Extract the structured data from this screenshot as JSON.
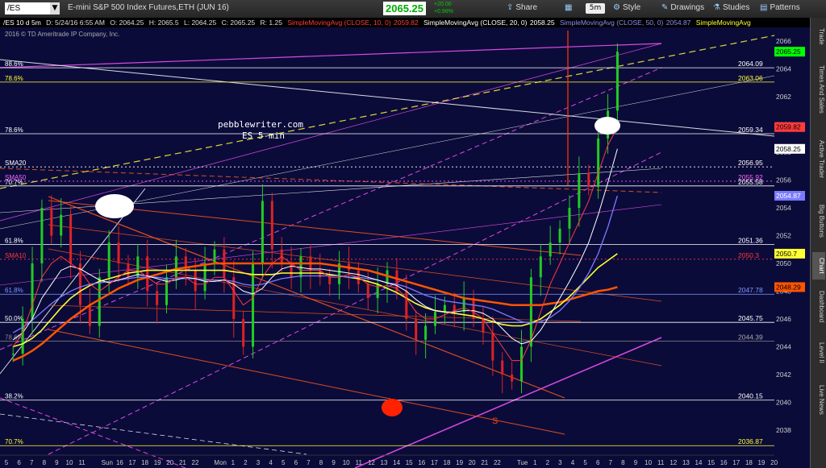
{
  "toolbar": {
    "symbol": "/ES",
    "description": "E-mini S&P 500 Index Futures,ETH (JUN 16)",
    "last_price": "2065.25",
    "change": "+20.00",
    "change_pct": "+0.98%",
    "share_label": "Share",
    "timeframe_label": "5m",
    "style_label": "Style",
    "drawings_label": "Drawings",
    "studies_label": "Studies",
    "patterns_label": "Patterns"
  },
  "infobar": {
    "chart_title": "/ES 10 d 5m",
    "date": "D: 5/24/16 6:55 AM",
    "open": "O: 2064.25",
    "high": "H: 2065.5",
    "low": "L: 2064.25",
    "close": "C: 2065.25",
    "range": "R: 1.25",
    "sma10_label": "SimpleMovingAvg (CLOSE, 10, 0)",
    "sma10_value": "2059.82",
    "sma20_label": "SimpleMovingAvg (CLOSE, 20, 0)",
    "sma20_value": "2058.25",
    "sma50_label": "SimpleMovingAvg (CLOSE, 50, 0)",
    "sma50_value": "2054.87",
    "sma_extra_label": "SimpleMovingAvg",
    "copyright": "2016 © TD Ameritrade IP Company, Inc."
  },
  "sidebar": {
    "tabs": [
      "Trade",
      "Times And Sales",
      "Active Trader",
      "Big Buttons",
      "Chart",
      "Dashboard",
      "Level II",
      "Live News"
    ],
    "active": "Chart"
  },
  "colors": {
    "background": "#0b0b3a",
    "sma10": "#ff3b3b",
    "sma20": "#ffffff",
    "sma50": "#7b7bff",
    "sma_long": "#ff5500",
    "sma_mid": "#ffff33",
    "channel_pink": "#ff55ff",
    "channel_orange": "#ff5a1a",
    "fib_yellow": "#ffff33"
  },
  "chart_data": {
    "type": "candlestick",
    "annotation_title": "pebblewriter.com",
    "annotation_subtitle": "ES 5-min",
    "annotation_s": "S",
    "y_range": [
      2037,
      2067
    ],
    "y_ticks": [
      2038,
      2040,
      2042,
      2044,
      2046,
      2048,
      2050,
      2052,
      2054,
      2056,
      2058,
      2060,
      2062,
      2064,
      2066
    ],
    "x_ticks": [
      {
        "label": "5",
        "i": 0
      },
      {
        "label": "6",
        "i": 1
      },
      {
        "label": "7",
        "i": 2
      },
      {
        "label": "8",
        "i": 3
      },
      {
        "label": "9",
        "i": 4
      },
      {
        "label": "10",
        "i": 5
      },
      {
        "label": "11",
        "i": 6
      },
      {
        "label": "Sun",
        "i": 8
      },
      {
        "label": "16",
        "i": 9
      },
      {
        "label": "17",
        "i": 10
      },
      {
        "label": "18",
        "i": 11
      },
      {
        "label": "19",
        "i": 12
      },
      {
        "label": "20",
        "i": 13
      },
      {
        "label": "21",
        "i": 14
      },
      {
        "label": "22",
        "i": 15
      },
      {
        "label": "Mon",
        "i": 17
      },
      {
        "label": "1",
        "i": 18
      },
      {
        "label": "2",
        "i": 19
      },
      {
        "label": "3",
        "i": 20
      },
      {
        "label": "4",
        "i": 21
      },
      {
        "label": "5",
        "i": 22
      },
      {
        "label": "6",
        "i": 23
      },
      {
        "label": "7",
        "i": 24
      },
      {
        "label": "8",
        "i": 25
      },
      {
        "label": "9",
        "i": 26
      },
      {
        "label": "10",
        "i": 27
      },
      {
        "label": "11",
        "i": 28
      },
      {
        "label": "12",
        "i": 29
      },
      {
        "label": "13",
        "i": 30
      },
      {
        "label": "14",
        "i": 31
      },
      {
        "label": "15",
        "i": 32
      },
      {
        "label": "16",
        "i": 33
      },
      {
        "label": "17",
        "i": 34
      },
      {
        "label": "18",
        "i": 35
      },
      {
        "label": "19",
        "i": 36
      },
      {
        "label": "20",
        "i": 37
      },
      {
        "label": "21",
        "i": 38
      },
      {
        "label": "22",
        "i": 39
      },
      {
        "label": "Tue",
        "i": 41
      },
      {
        "label": "1",
        "i": 42
      },
      {
        "label": "2",
        "i": 43
      },
      {
        "label": "3",
        "i": 44
      },
      {
        "label": "4",
        "i": 45
      },
      {
        "label": "5",
        "i": 46
      },
      {
        "label": "6",
        "i": 47
      },
      {
        "label": "7",
        "i": 48
      },
      {
        "label": "8",
        "i": 49
      },
      {
        "label": "9",
        "i": 50
      },
      {
        "label": "10",
        "i": 51
      },
      {
        "label": "11",
        "i": 52
      },
      {
        "label": "12",
        "i": 53
      },
      {
        "label": "13",
        "i": 54
      },
      {
        "label": "14",
        "i": 55
      },
      {
        "label": "15",
        "i": 56
      },
      {
        "label": "16",
        "i": 57
      },
      {
        "label": "17",
        "i": 58
      },
      {
        "label": "18",
        "i": 59
      },
      {
        "label": "19",
        "i": 60
      },
      {
        "label": "20",
        "i": 61
      }
    ],
    "levels": [
      {
        "value": 2064.09,
        "label": "2064.09",
        "left": "88.6%",
        "color": "#ffffff",
        "style": "solid"
      },
      {
        "value": 2063.06,
        "label": "2063.06",
        "left": "78.6%",
        "color": "#ffff33",
        "style": "solid"
      },
      {
        "value": 2059.34,
        "label": "2059.34",
        "left": "78.6%",
        "color": "#ffffff",
        "style": "solid"
      },
      {
        "value": 2056.95,
        "label": "2056.95",
        "left": "SMA20",
        "color": "#ffffff",
        "style": "dotted"
      },
      {
        "value": 2055.92,
        "label": "2055.92",
        "left": "SMA50",
        "color": "#ff66ff",
        "style": "dotted"
      },
      {
        "value": 2055.58,
        "label": "2055.58",
        "left": "70.7%",
        "color": "#ffffff",
        "style": "solid"
      },
      {
        "value": 2051.36,
        "label": "2051.36",
        "left": "61.8%",
        "color": "#ffffff",
        "style": "solid"
      },
      {
        "value": 2050.3,
        "label": "2050.3",
        "left": "SMA10",
        "color": "#ff3b3b",
        "style": "dotted"
      },
      {
        "value": 2047.78,
        "label": "2047.78",
        "left": "61.8%",
        "color": "#7b9cff",
        "style": "solid"
      },
      {
        "value": 2045.75,
        "label": "2045.75",
        "left": "50.0%",
        "color": "#ffffff",
        "style": "solid"
      },
      {
        "value": 2044.39,
        "label": "2044.39",
        "left": "78.6%",
        "color": "#888888",
        "style": "solid"
      },
      {
        "value": 2040.15,
        "label": "2040.15",
        "left": "38.2%",
        "color": "#ffffff",
        "style": "solid"
      },
      {
        "value": 2036.87,
        "label": "2036.87",
        "left": "70.7%",
        "color": "#ffff33",
        "style": "solid"
      }
    ],
    "price_tags": [
      {
        "value": 2065.25,
        "label": "2065.25",
        "bg": "#00ff00",
        "fg": "#000"
      },
      {
        "value": 2059.82,
        "label": "2059.82",
        "bg": "#ff3b3b",
        "fg": "#000"
      },
      {
        "value": 2058.25,
        "label": "2058.25",
        "bg": "#ffffff",
        "fg": "#000"
      },
      {
        "value": 2054.87,
        "label": "2054.87",
        "bg": "#7b7bff",
        "fg": "#fff"
      },
      {
        "value": 2050.7,
        "label": "2050.7",
        "bg": "#ffff33",
        "fg": "#000"
      },
      {
        "value": 2048.29,
        "label": "2048.29",
        "bg": "#ff5500",
        "fg": "#000"
      }
    ],
    "close_path": [
      2043.5,
      2046,
      2050,
      2054,
      2052,
      2053.5,
      2050,
      2047,
      2045.5,
      2049,
      2051.5,
      2050,
      2049,
      2050.5,
      2048,
      2047,
      2049,
      2050.5,
      2049.5,
      2048,
      2050,
      2051,
      2049,
      2046,
      2044,
      2050,
      2054.5,
      2051,
      2050,
      2049,
      2050.5,
      2049.5,
      2049,
      2048.5,
      2050,
      2049.5,
      2048.5,
      2047.5,
      2048.5,
      2049.5,
      2048,
      2046,
      2044.5,
      2045.5,
      2046.5,
      2047,
      2046.5,
      2047.5,
      2046,
      2045,
      2043,
      2042,
      2041.5,
      2044,
      2049,
      2050.5,
      2051.5,
      2052.5,
      2054,
      2056.5,
      2055.5,
      2059,
      2061,
      2065.25
    ],
    "sma10": [
      2044,
      2045,
      2047,
      2049,
      2050,
      2050.5,
      2050,
      2049.5,
      2048.5,
      2048,
      2048.5,
      2049,
      2049.5,
      2049.5,
      2049,
      2048.5,
      2048.5,
      2049,
      2049,
      2048.5,
      2048.5,
      2049,
      2049,
      2048,
      2047,
      2047.5,
      2049,
      2050,
      2050.5,
      2050,
      2049.5,
      2049.5,
      2049.5,
      2049,
      2049,
      2049.2,
      2049,
      2048.5,
      2048.3,
      2048.4,
      2048.2,
      2047.5,
      2046.5,
      2046,
      2046,
      2046.3,
      2046.6,
      2046.8,
      2046.5,
      2046,
      2045,
      2044,
      2043,
      2043,
      2044.5,
      2046.5,
      2048.5,
      2050,
      2051.5,
      2053,
      2054.5,
      2056.5,
      2058.5,
      2059.82
    ],
    "sma20": [
      2044.5,
      2045,
      2046,
      2047.5,
      2048.5,
      2049.5,
      2049.8,
      2049.6,
      2049.2,
      2048.8,
      2048.6,
      2048.8,
      2049,
      2049.2,
      2049.1,
      2048.9,
      2048.7,
      2048.8,
      2049,
      2048.9,
      2048.7,
      2048.7,
      2048.8,
      2048.5,
      2048,
      2047.8,
      2048.2,
      2049,
      2049.6,
      2049.8,
      2049.7,
      2049.6,
      2049.6,
      2049.5,
      2049.4,
      2049.3,
      2049.2,
      2049,
      2048.8,
      2048.6,
      2048.4,
      2048,
      2047.4,
      2046.9,
      2046.6,
      2046.5,
      2046.5,
      2046.6,
      2046.6,
      2046.4,
      2046,
      2045.3,
      2044.6,
      2044.2,
      2044.4,
      2045.2,
      2046.3,
      2047.5,
      2048.7,
      2050,
      2051.5,
      2053.5,
      2055.8,
      2058.25
    ],
    "sma50": [
      2045,
      2045.4,
      2045.9,
      2046.5,
      2047.1,
      2047.6,
      2048,
      2048.3,
      2048.5,
      2048.6,
      2048.7,
      2048.8,
      2048.9,
      2049,
      2049,
      2049,
      2048.9,
      2048.9,
      2048.9,
      2048.9,
      2048.8,
      2048.8,
      2048.8,
      2048.7,
      2048.5,
      2048.4,
      2048.5,
      2048.7,
      2048.9,
      2049,
      2049.1,
      2049.1,
      2049.1,
      2049.1,
      2049.1,
      2049,
      2049,
      2048.9,
      2048.8,
      2048.6,
      2048.5,
      2048.3,
      2048,
      2047.7,
      2047.5,
      2047.3,
      2047.2,
      2047.1,
      2047,
      2046.9,
      2046.7,
      2046.4,
      2046.1,
      2045.8,
      2045.7,
      2045.8,
      2046.1,
      2046.6,
      2047.3,
      2048.2,
      2049.3,
      2050.7,
      2052.6,
      2054.87
    ],
    "sma_mid": [
      2044,
      2044.2,
      2044.6,
      2045.2,
      2046,
      2046.8,
      2047.5,
      2048,
      2048.4,
      2048.7,
      2048.9,
      2049.1,
      2049.3,
      2049.4,
      2049.5,
      2049.5,
      2049.5,
      2049.5,
      2049.5,
      2049.5,
      2049.5,
      2049.5,
      2049.5,
      2049.4,
      2049.3,
      2049.2,
      2049.2,
      2049.2,
      2049.3,
      2049.3,
      2049.3,
      2049.3,
      2049.3,
      2049.2,
      2049.1,
      2049,
      2048.9,
      2048.7,
      2048.5,
      2048.2,
      2047.9,
      2047.5,
      2047.1,
      2046.8,
      2046.6,
      2046.5,
      2046.4,
      2046.3,
      2046.2,
      2046,
      2045.8,
      2045.6,
      2045.5,
      2045.5,
      2045.7,
      2046,
      2046.5,
      2047,
      2047.6,
      2048.3,
      2049,
      2049.7,
      2050.2,
      2050.7
    ],
    "sma_long": [
      2043,
      2043.3,
      2043.7,
      2044.2,
      2044.8,
      2045.4,
      2046,
      2046.5,
      2047,
      2047.4,
      2047.8,
      2048.2,
      2048.5,
      2048.8,
      2049,
      2049.2,
      2049.4,
      2049.6,
      2049.7,
      2049.8,
      2049.9,
      2050,
      2050,
      2050,
      2050,
      2050,
      2050,
      2050,
      2050,
      2050,
      2050,
      2050,
      2050,
      2049.9,
      2049.8,
      2049.7,
      2049.6,
      2049.5,
      2049.3,
      2049.1,
      2048.9,
      2048.7,
      2048.5,
      2048.3,
      2048.1,
      2047.9,
      2047.7,
      2047.5,
      2047.4,
      2047.3,
      2047.2,
      2047.1,
      2047,
      2047,
      2047,
      2047,
      2047.1,
      2047.2,
      2047.4,
      2047.6,
      2047.8,
      2048,
      2048.1,
      2048.29
    ]
  }
}
